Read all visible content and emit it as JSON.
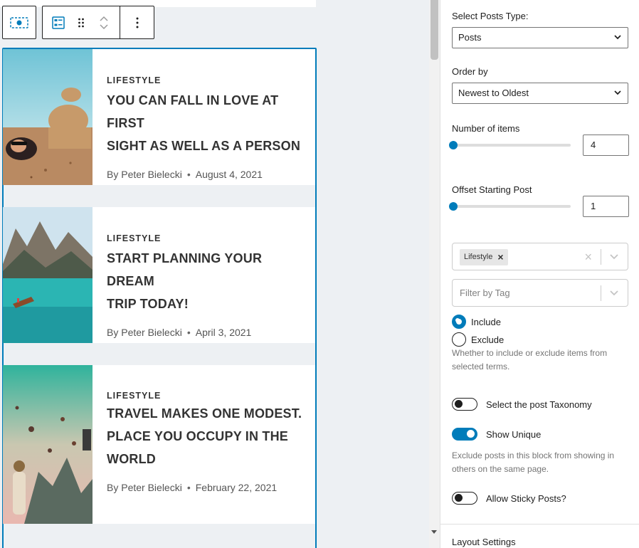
{
  "posts": [
    {
      "category": "LIFESTYLE",
      "title_line1": "YOU CAN FALL IN LOVE AT FIRST",
      "title_line2": "SIGHT AS WELL AS A PERSON",
      "title_line3": "",
      "author": "By Peter Bielecki",
      "date": "August 4, 2021"
    },
    {
      "category": "LIFESTYLE",
      "title_line1": "START PLANNING YOUR DREAM",
      "title_line2": "TRIP TODAY!",
      "title_line3": "",
      "author": "By Peter Bielecki",
      "date": "April 3, 2021"
    },
    {
      "category": "LIFESTYLE",
      "title_line1": "TRAVEL MAKES ONE MODEST.",
      "title_line2": "PLACE YOU OCCUPY IN THE",
      "title_line3": "WORLD",
      "author": "By Peter Bielecki",
      "date": "February 22, 2021"
    }
  ],
  "settings": {
    "post_type_label": "Select Posts Type:",
    "post_type_value": "Posts",
    "order_label": "Order by",
    "order_value": "Newest to Oldest",
    "items_label": "Number of items",
    "items_value": "4",
    "items_level": 0,
    "offset_label": "Offset Starting Post",
    "offset_value": "1",
    "offset_level": 0,
    "category_token": "Lifestyle",
    "tag_placeholder": "Filter by Tag",
    "include_label": "Include",
    "exclude_label": "Exclude",
    "include_help": "Whether to include or exclude items from selected terms.",
    "taxonomy_label": "Select the post Taxonomy",
    "taxonomy_on": false,
    "unique_label": "Show Unique",
    "unique_on": true,
    "unique_help": "Exclude posts in this block from showing in others on the same page.",
    "sticky_label": "Allow Sticky Posts?",
    "sticky_on": false,
    "next_section_label": "Layout Settings"
  },
  "colors": {
    "accent": "#007cba",
    "canvas_bg": "#edf0f3",
    "text": "#1e1e1e",
    "muted": "#757575"
  },
  "icons": [
    "block-select-icon",
    "posts-block-icon",
    "drag-handle-icon",
    "move-up-icon",
    "move-down-icon",
    "more-options-icon",
    "chevron-down-icon",
    "clear-icon",
    "remove-token-icon"
  ]
}
